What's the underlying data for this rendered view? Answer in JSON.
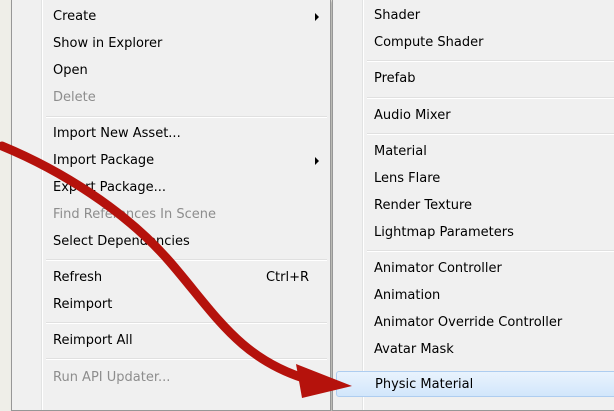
{
  "context_menu": {
    "items": [
      {
        "label": "Create"
      },
      {
        "label": "Show in Explorer"
      },
      {
        "label": "Open"
      },
      {
        "label": "Delete"
      },
      {
        "label": "Import New Asset..."
      },
      {
        "label": "Import Package"
      },
      {
        "label": "Export Package..."
      },
      {
        "label": "Find References In Scene"
      },
      {
        "label": "Select Dependencies"
      },
      {
        "label": "Refresh",
        "shortcut": "Ctrl+R"
      },
      {
        "label": "Reimport"
      },
      {
        "label": "Reimport All"
      },
      {
        "label": "Run API Updater..."
      }
    ]
  },
  "create_submenu": {
    "items": [
      {
        "label": "Shader"
      },
      {
        "label": "Compute Shader"
      },
      {
        "label": "Prefab"
      },
      {
        "label": "Audio Mixer"
      },
      {
        "label": "Material"
      },
      {
        "label": "Lens Flare"
      },
      {
        "label": "Render Texture"
      },
      {
        "label": "Lightmap Parameters"
      },
      {
        "label": "Animator Controller"
      },
      {
        "label": "Animation"
      },
      {
        "label": "Animator Override Controller"
      },
      {
        "label": "Avatar Mask"
      },
      {
        "label": "Physic Material"
      }
    ]
  },
  "annotation": {
    "arrow_color": "#b5120c"
  }
}
